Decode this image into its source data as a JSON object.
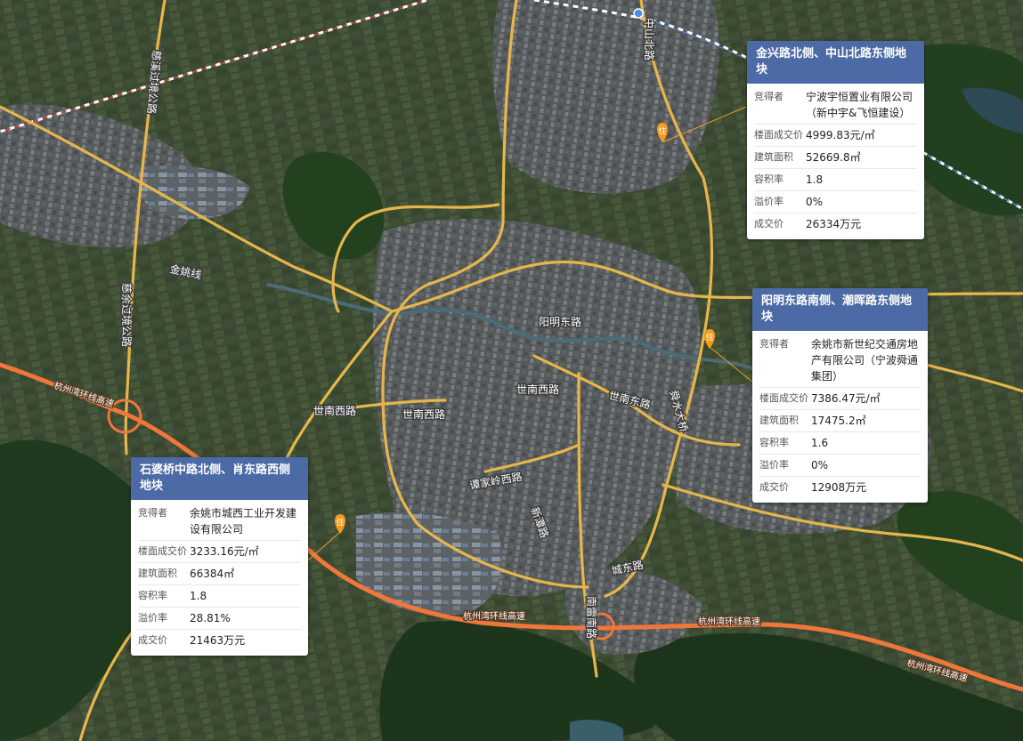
{
  "map": {
    "road_labels": {
      "zhongshan_north": "中山北路",
      "yangming_east": "阳明东路",
      "shinan_west_1": "世南西路",
      "shinan_west_2": "世南西路",
      "shinan_west_3": "世南西路",
      "shinan_east": "世南东路",
      "shunshui": "舜水大桥",
      "tanjialing_west": "谭家岭西路",
      "chengdong": "城东路",
      "nanlei_south": "南雷南路",
      "xintan": "新潭路",
      "jinyao": "金姚线",
      "cixi_pass_north": "慈溪过境公路",
      "cixi_pass_south": "慈余过境公路",
      "hangzhou_bay_1": "杭州湾环线高速",
      "hangzhou_bay_2": "杭州湾环线高速",
      "hangzhou_bay_3": "杭州湾环线高速",
      "hangzhou_bay_4": "杭州湾环线高速"
    },
    "colors": {
      "road": "#e7b64a",
      "expressway": "#f0763a",
      "card_header": "#4c6aa6",
      "pin": "#f39a1e"
    },
    "marker_icon": "residential-pin-icon",
    "marker_label": "住"
  },
  "parcels": [
    {
      "title": "金兴路北侧、中山北路东侧地块",
      "rows": [
        {
          "key": "竞得者",
          "value": "宁波宇恒置业有限公司（新中宇&飞恒建设）"
        },
        {
          "key": "楼面成交价",
          "value": "4999.83元/㎡"
        },
        {
          "key": "建筑面积",
          "value": "52669.8㎡"
        },
        {
          "key": "容积率",
          "value": "1.8"
        },
        {
          "key": "溢价率",
          "value": "0%"
        },
        {
          "key": "成交价",
          "value": "26334万元"
        }
      ]
    },
    {
      "title": "阳明东路南侧、潮晖路东侧地块",
      "rows": [
        {
          "key": "竞得者",
          "value": "余姚市新世纪交通房地产有限公司（宁波舜通集团）"
        },
        {
          "key": "楼面成交价",
          "value": "7386.47元/㎡"
        },
        {
          "key": "建筑面积",
          "value": "17475.2㎡"
        },
        {
          "key": "容积率",
          "value": "1.6"
        },
        {
          "key": "溢价率",
          "value": "0%"
        },
        {
          "key": "成交价",
          "value": "12908万元"
        }
      ]
    },
    {
      "title": "石婆桥中路北侧、肖东路西侧地块",
      "rows": [
        {
          "key": "竞得者",
          "value": "余姚市城西工业开发建设有限公司"
        },
        {
          "key": "楼面成交价",
          "value": "3233.16元/㎡"
        },
        {
          "key": "建筑面积",
          "value": "66384㎡"
        },
        {
          "key": "容积率",
          "value": "1.8"
        },
        {
          "key": "溢价率",
          "value": "28.81%"
        },
        {
          "key": "成交价",
          "value": "21463万元"
        }
      ]
    }
  ]
}
